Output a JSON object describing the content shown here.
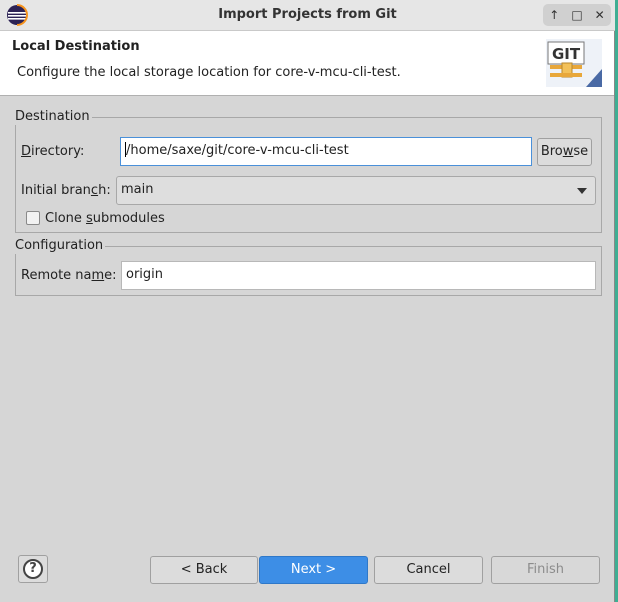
{
  "window": {
    "title": "Import Projects from Git",
    "controls": [
      "↑",
      "□",
      "✕"
    ]
  },
  "banner": {
    "title": "Local Destination",
    "description": "Configure the local storage location for core-v-mcu-cli-test.",
    "logo_text": "GIT"
  },
  "destination": {
    "group_title": "Destination",
    "directory_label_mnemonic": "D",
    "directory_label_rest": "irectory:",
    "directory_value": "/home/saxe/git/core-v-mcu-cli-test",
    "browse_pre": "Bro",
    "browse_mnemonic": "w",
    "browse_post": "se",
    "branch_label_pre": "Initial bran",
    "branch_label_mnemonic": "c",
    "branch_label_post": "h:",
    "branch_value": "main",
    "clone_pre": "Clone ",
    "clone_mnemonic": "s",
    "clone_post": "ubmodules",
    "clone_checked": false
  },
  "configuration": {
    "group_title": "Configuration",
    "remote_label_pre": "Remote na",
    "remote_label_mnemonic": "m",
    "remote_label_post": "e:",
    "remote_value": "origin"
  },
  "footer": {
    "help_symbol": "?",
    "back_label": "< Back",
    "next_label": "Next >",
    "cancel_label": "Cancel",
    "finish_label": "Finish"
  },
  "colors": {
    "accent": "#3d8ee6",
    "desktop": "#3fae93"
  }
}
